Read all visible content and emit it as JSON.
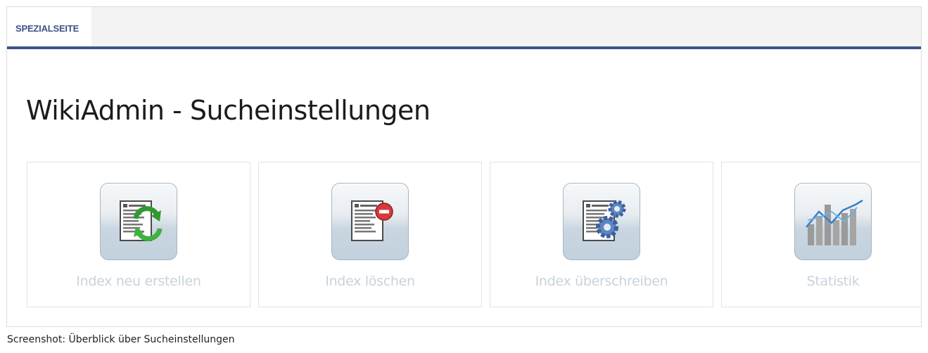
{
  "tab": {
    "label": "SPEZIALSEITE"
  },
  "page": {
    "title": "WikiAdmin - Sucheinstellungen"
  },
  "cards": [
    {
      "label": "Index neu erstellen",
      "icon": "document-refresh-icon"
    },
    {
      "label": "Index löschen",
      "icon": "document-delete-icon"
    },
    {
      "label": "Index überschreiben",
      "icon": "document-settings-icon"
    },
    {
      "label": "Statistik",
      "icon": "statistics-chart-icon"
    }
  ],
  "caption": "Screenshot: Überblick über Sucheinstellungen",
  "colors": {
    "accent": "#3e5389",
    "card_label": "#c7d3dc"
  }
}
